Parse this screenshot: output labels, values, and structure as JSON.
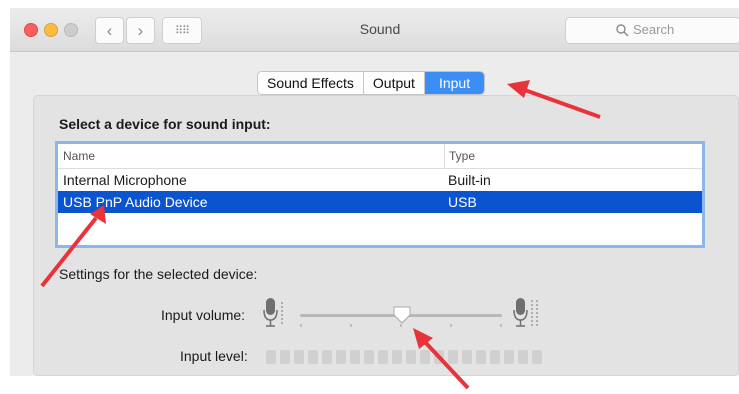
{
  "window": {
    "title": "Sound",
    "search_placeholder": "Search",
    "back_glyph": "‹",
    "forward_glyph": "›",
    "grid_glyph": "⠿⠿"
  },
  "tabs": [
    {
      "label": "Sound Effects",
      "active": false
    },
    {
      "label": "Output",
      "active": false
    },
    {
      "label": "Input",
      "active": true
    }
  ],
  "input": {
    "select_label": "Select a device for sound input:",
    "columns": [
      "Name",
      "Type"
    ],
    "devices": [
      {
        "name": "Internal Microphone",
        "type": "Built-in",
        "selected": false
      },
      {
        "name": "USB PnP Audio Device",
        "type": "USB",
        "selected": true
      }
    ],
    "settings_label": "Settings for the selected device:",
    "volume_label": "Input volume:",
    "volume_fraction": 0.5,
    "level_label": "Input level:",
    "level_active_segments": 0
  },
  "colors": {
    "accent": "#3a8ef6",
    "selection": "#0a55cf",
    "annotation": "#e8333a"
  }
}
